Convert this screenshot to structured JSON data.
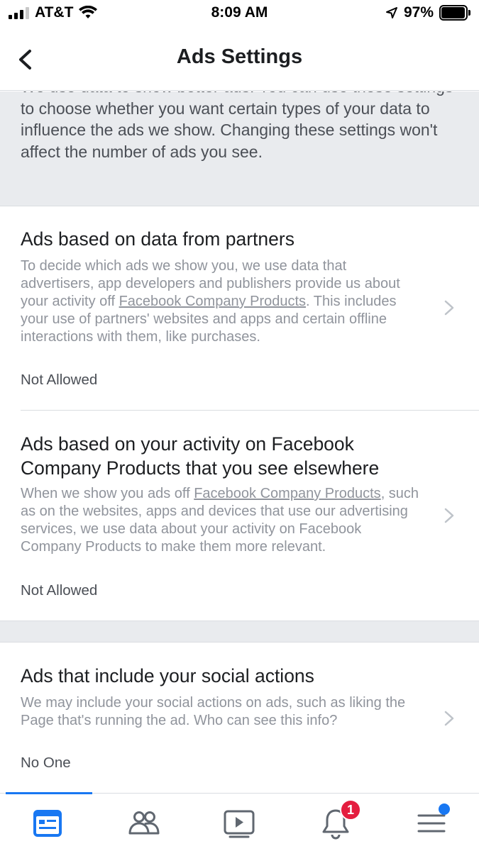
{
  "status_bar": {
    "carrier": "AT&T",
    "time": "8:09 AM",
    "battery": "97%"
  },
  "nav": {
    "title": "Ads Settings"
  },
  "intro": {
    "text": "We use data to show better ads. You can use these settings to choose whether you want certain types of your data to influence the ads we show. Changing these settings won't affect the number of ads you see."
  },
  "settings": [
    {
      "title": "Ads based on data from partners",
      "desc_before": "To decide which ads we show you, we use data that advertisers, app developers and publishers provide us about your activity off ",
      "link": "Facebook Company Products",
      "desc_after": ". This includes your use of partners' websites and apps and certain offline interactions with them, like purchases.",
      "value": "Not Allowed"
    },
    {
      "title": "Ads based on your activity on Facebook Company Products that you see elsewhere",
      "desc_before": "When we show you ads off ",
      "link": "Facebook Company Products",
      "desc_after": ", such as on the websites, apps and devices that use our advertising services, we use data about your activity on Facebook Company Products to make them more relevant.",
      "value": "Not Allowed"
    },
    {
      "title": "Ads that include your social actions",
      "desc_before": "We may include your social actions on ads, such as liking the Page that's running the ad. Who can see this info?",
      "link": "",
      "desc_after": "",
      "value": "No One"
    }
  ],
  "tab_bar": {
    "tabs": [
      {
        "icon": "news-feed-icon",
        "active": true
      },
      {
        "icon": "friends-icon",
        "active": false
      },
      {
        "icon": "watch-icon",
        "active": false
      },
      {
        "icon": "notifications-icon",
        "active": false,
        "badge": "1"
      },
      {
        "icon": "menu-icon",
        "active": false
      }
    ],
    "accent_color": "#1877f2"
  }
}
